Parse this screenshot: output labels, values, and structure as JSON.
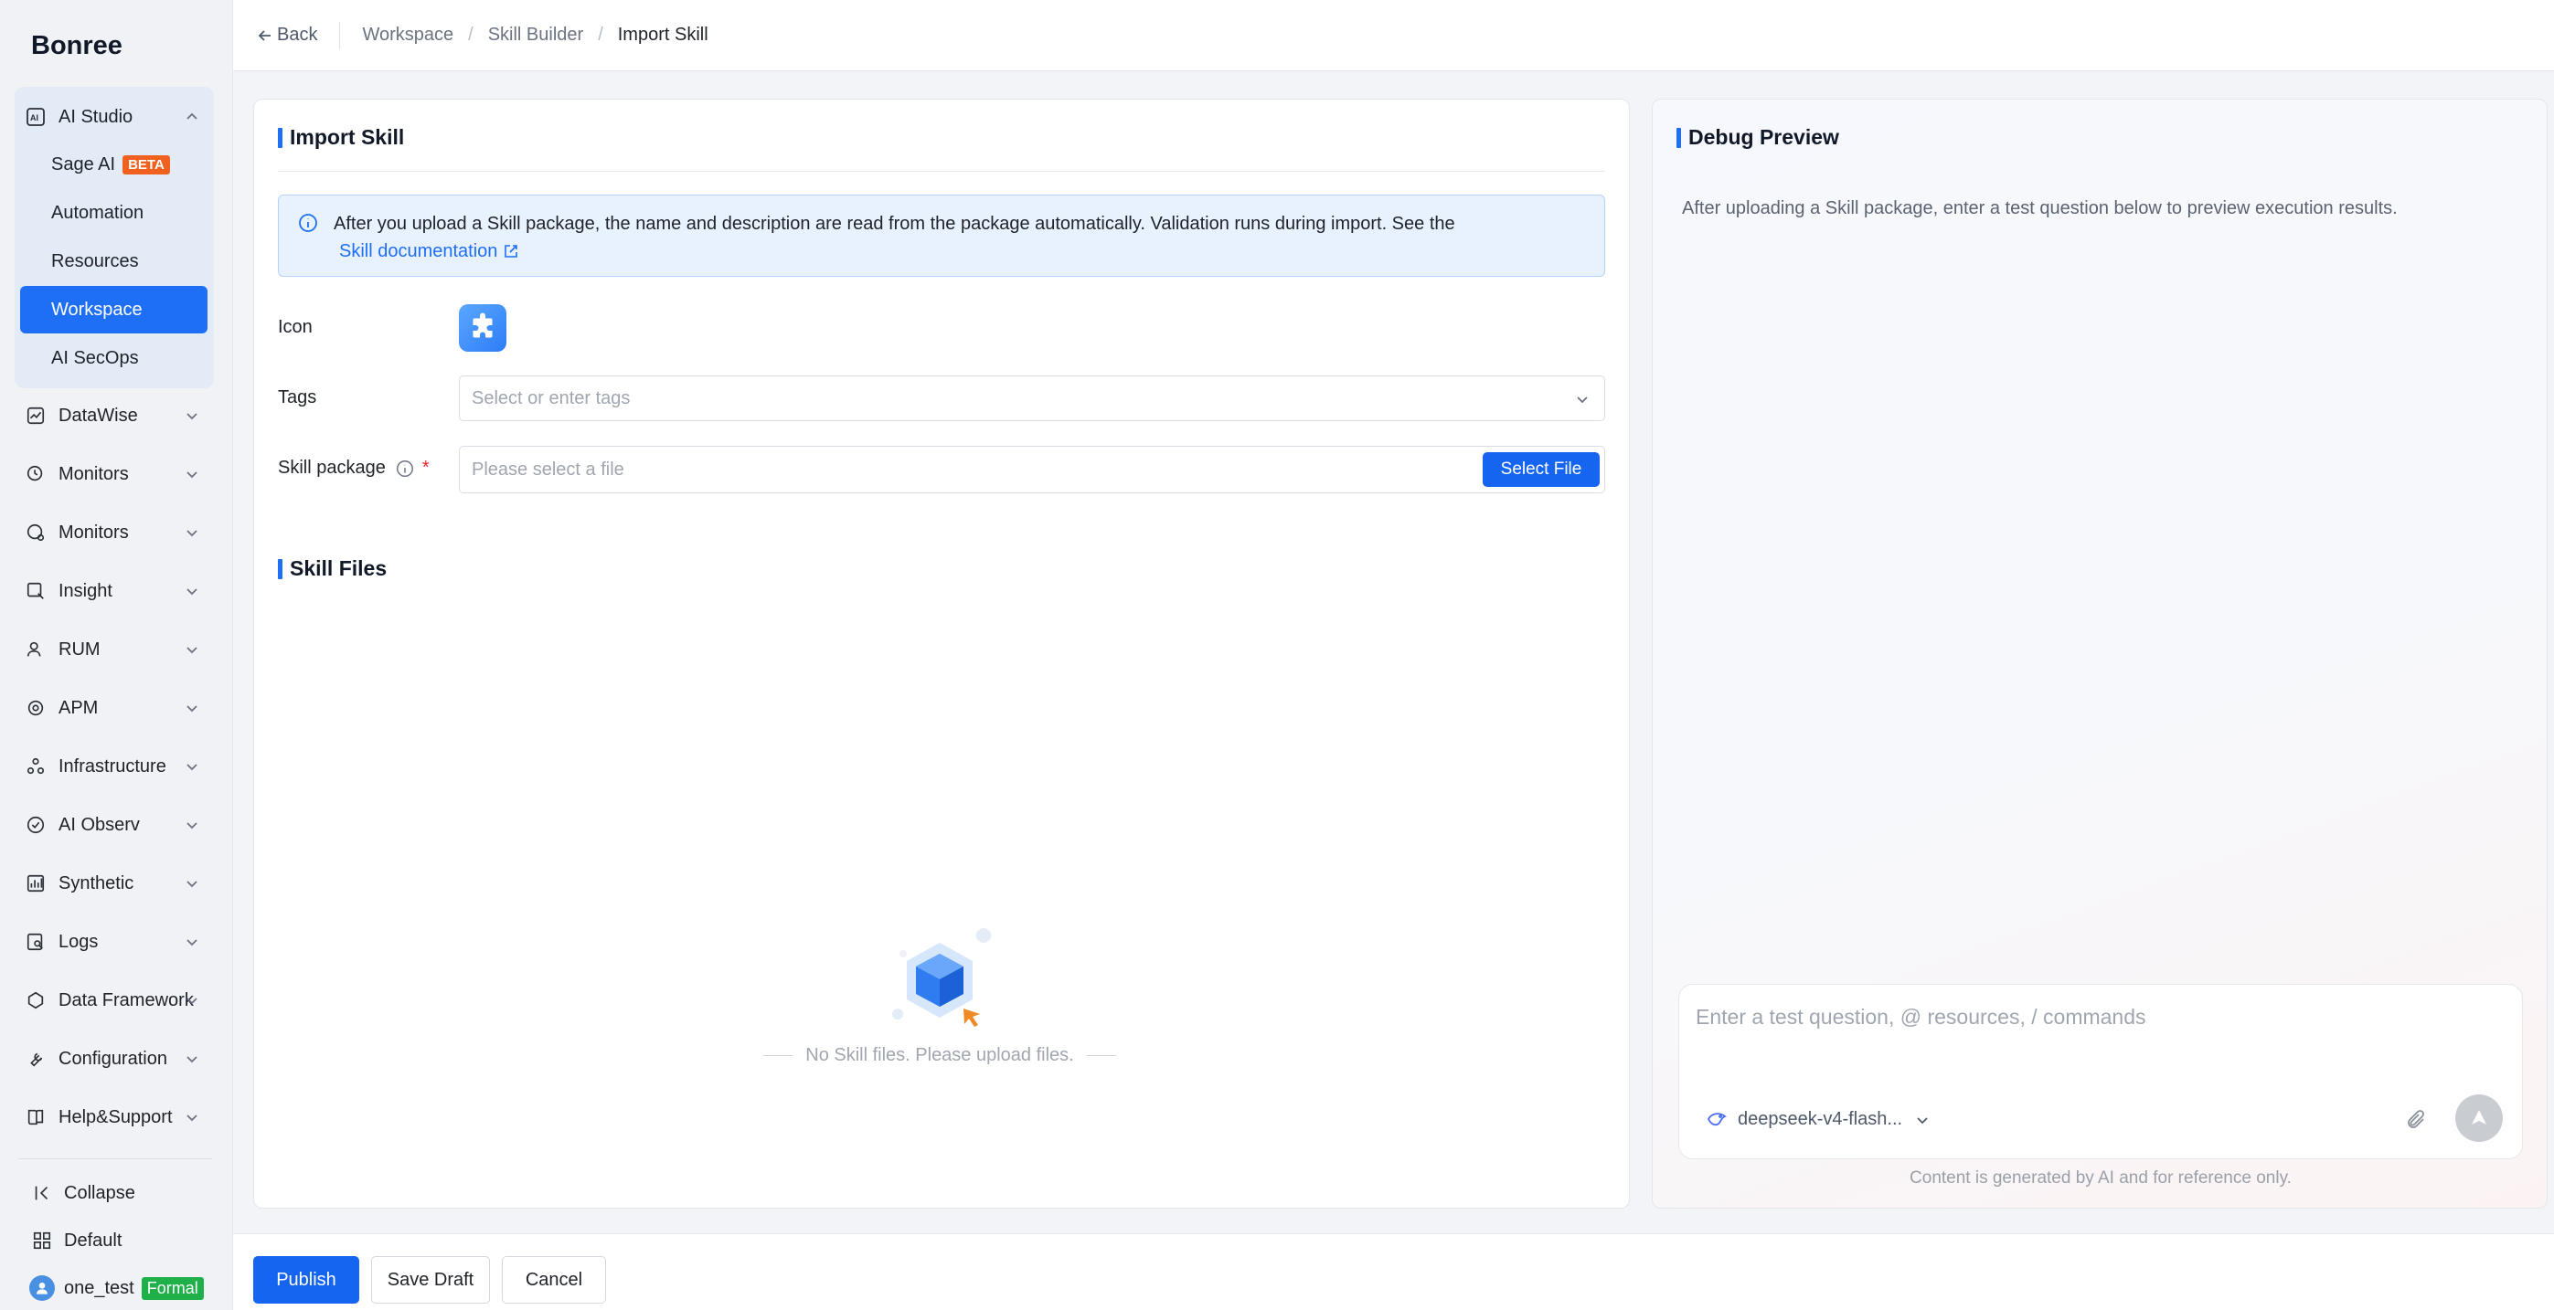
{
  "brand": "Bonree",
  "nav": {
    "ai_studio": {
      "label": "AI Studio",
      "icon": "ai-studio-icon"
    },
    "ai_sub": [
      {
        "label": "Sage AI",
        "badge": "BETA"
      },
      {
        "label": "Automation"
      },
      {
        "label": "Resources"
      },
      {
        "label": "Workspace",
        "active": true
      },
      {
        "label": "AI SecOps"
      }
    ],
    "groups": [
      {
        "label": "DataWise",
        "icon": "chart-icon"
      },
      {
        "label": "Monitors",
        "icon": "monitor-icon"
      },
      {
        "label": "Monitors",
        "icon": "monitor-alt-icon"
      },
      {
        "label": "Insight",
        "icon": "insight-icon"
      },
      {
        "label": "RUM",
        "icon": "user-icon"
      },
      {
        "label": "APM",
        "icon": "apm-icon"
      },
      {
        "label": "Infrastructure",
        "icon": "infrastructure-icon"
      },
      {
        "label": "AI Observ",
        "icon": "ai-observ-icon"
      },
      {
        "label": "Synthetic",
        "icon": "synthetic-icon"
      },
      {
        "label": "Logs",
        "icon": "logs-icon"
      },
      {
        "label": "Data Framework",
        "icon": "data-framework-icon"
      },
      {
        "label": "Configuration",
        "icon": "wrench-icon"
      },
      {
        "label": "Help&Support",
        "icon": "book-icon"
      }
    ],
    "collapse": "Collapse",
    "default": "Default",
    "user": {
      "name": "one_test",
      "env": "Formal"
    }
  },
  "topbar": {
    "back": "Back",
    "breadcrumb": [
      "Workspace",
      "Skill Builder",
      "Import Skill"
    ]
  },
  "import": {
    "title": "Import Skill",
    "info_text": "After you upload a Skill package, the name and description are read from the package automatically. Validation runs during import. See the",
    "info_link": "Skill documentation",
    "icon_label": "Icon",
    "tags_label": "Tags",
    "tags_placeholder": "Select or enter tags",
    "package_label": "Skill package",
    "package_placeholder": "Please select a file",
    "select_file": "Select File",
    "files_title": "Skill Files",
    "empty_text": "No Skill files. Please upload files."
  },
  "debug": {
    "title": "Debug Preview",
    "hint": "After uploading a Skill package, enter a test question below to preview execution results.",
    "input_placeholder": "Enter a test question, @ resources, / commands",
    "model": "deepseek-v4-flash...",
    "disclaimer": "Content is generated by AI and for reference only."
  },
  "footer": {
    "publish": "Publish",
    "save_draft": "Save Draft",
    "cancel": "Cancel"
  },
  "colors": {
    "primary": "#1565f0",
    "beta_badge": "#f0611f",
    "formal_badge": "#1fb04a",
    "sidebar_bg": "#f0f2f6"
  }
}
